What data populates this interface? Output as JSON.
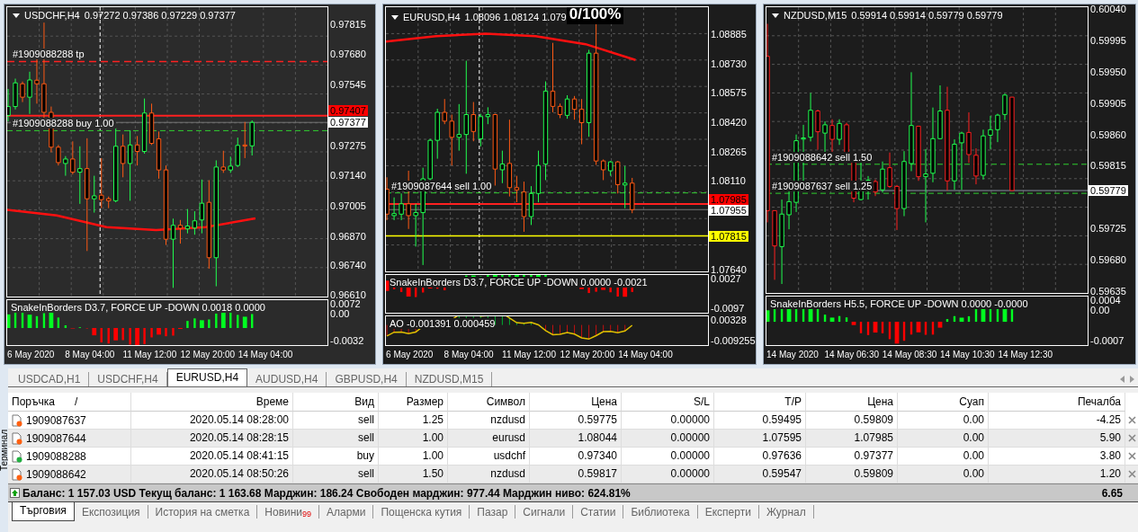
{
  "charts": [
    {
      "title": "USDCHF,H4",
      "ohlc": "0.97272 0.97386 0.97229 0.97377",
      "price_labels": [
        "0.97815",
        "0.97680",
        "0.97545",
        "0.97275",
        "0.97140",
        "0.97005",
        "0.96870",
        "0.96740",
        "0.96610"
      ],
      "price_tags": [
        {
          "text": "0.97407",
          "color": "#ff0000"
        },
        {
          "text": "0.97377",
          "color": "#ffffff"
        }
      ],
      "order_labels": [
        "#1909088288 tp",
        "#1909088288 buy 1.00"
      ],
      "indicators": [
        {
          "kind": "histogram",
          "title": "SnakeInBorders D3.7, FORCE UP -DOWN  0.0018 0.0000",
          "scale": [
            "0.0072",
            "0.00",
            "-0.0032"
          ]
        }
      ],
      "time_labels": [
        "6 May 2020",
        "8 May 04:00",
        "11 May 12:00",
        "12 May 20:00",
        "14 May 04:00"
      ]
    },
    {
      "title": "EURUSD,H4",
      "ohlc": "1.08096 1.08124 1.079",
      "overlay": "0/100%",
      "price_labels": [
        "1.08885",
        "1.08730",
        "1.08575",
        "1.08420",
        "1.08265",
        "1.08110",
        "1.07640"
      ],
      "price_tags": [
        {
          "text": "1.07985",
          "color": "#ff0000"
        },
        {
          "text": "1.07955",
          "color": "#ffffff"
        },
        {
          "text": "1.07815",
          "color": "#ffff00"
        }
      ],
      "order_labels": [
        "#1909087644 sell 1.00"
      ],
      "indicators": [
        {
          "kind": "histogram",
          "title": "SnakeInBorders D3.7, FORCE UP -DOWN  0.0000 -0.0021",
          "scale": [
            "0.0027",
            "-0.0097"
          ]
        },
        {
          "kind": "oscillator",
          "title": "AO -0.001391 0.000459",
          "scale": [
            "0.00328",
            "-0.009255"
          ]
        }
      ],
      "time_labels": [
        "6 May 2020",
        "8 May 04:00",
        "11 May 12:00",
        "12 May 20:00",
        "14 May 04:00"
      ]
    },
    {
      "title": "NZDUSD,M15",
      "ohlc": "0.59914 0.59914 0.59779 0.59779",
      "price_labels": [
        "0.60040",
        "0.59995",
        "0.59950",
        "0.59905",
        "0.59860",
        "0.59815",
        "0.59725",
        "0.59680",
        "0.59635"
      ],
      "price_tags": [
        {
          "text": "0.59779",
          "color": "#ffffff"
        }
      ],
      "order_labels": [
        "#1909088642 sell 1.50",
        "#1909087637 sell 1.25"
      ],
      "indicators": [
        {
          "kind": "histogram",
          "title": "SnakeInBorders H5.5, FORCE UP -DOWN  0.0000 -0.0000",
          "scale": [
            "0.0004",
            "0.00",
            "-0.0007"
          ]
        }
      ],
      "time_labels": [
        "14 May 2020",
        "14 May 06:30",
        "14 May 08:30",
        "14 May 10:30",
        "14 May 12:30"
      ]
    }
  ],
  "symbol_tabs": [
    {
      "label": "USDCAD,H1",
      "selected": false
    },
    {
      "label": "USDCHF,H4",
      "selected": false
    },
    {
      "label": "EURUSD,H4",
      "selected": true
    },
    {
      "label": "AUDUSD,H4",
      "selected": false
    },
    {
      "label": "GBPUSD,H4",
      "selected": false
    },
    {
      "label": "NZDUSD,M15",
      "selected": false
    }
  ],
  "side_label": "Терминал",
  "table": {
    "columns": [
      "Поръчка",
      "Време",
      "Вид",
      "Размер",
      "Символ",
      "Цена",
      "S/L",
      "T/P",
      "Цена",
      "Суап",
      "Печалба"
    ],
    "sort_mark": "/",
    "rows": [
      {
        "kind": "sell",
        "cells": [
          "1909087637",
          "2020.05.14 08:28:00",
          "sell",
          "1.25",
          "nzdusd",
          "0.59775",
          "0.00000",
          "0.59495",
          "0.59809",
          "0.00",
          "-4.25"
        ]
      },
      {
        "kind": "sell",
        "cells": [
          "1909087644",
          "2020.05.14 08:28:15",
          "sell",
          "1.00",
          "eurusd",
          "1.08044",
          "0.00000",
          "1.07595",
          "1.07985",
          "0.00",
          "5.90"
        ]
      },
      {
        "kind": "buy",
        "cells": [
          "1909088288",
          "2020.05.14 08:41:15",
          "buy",
          "1.00",
          "usdchf",
          "0.97340",
          "0.00000",
          "0.97636",
          "0.97377",
          "0.00",
          "3.80"
        ]
      },
      {
        "kind": "sell",
        "cells": [
          "1909088642",
          "2020.05.14 08:50:26",
          "sell",
          "1.50",
          "nzdusd",
          "0.59817",
          "0.00000",
          "0.59547",
          "0.59809",
          "0.00",
          "1.20"
        ]
      }
    ]
  },
  "balance": {
    "text": "Баланс: 1 157.03 USD  Текущ баланс: 1 163.68  Марджин: 186.24  Свободен марджин: 977.44  Марджин ниво: 624.81%",
    "total": "6.65"
  },
  "bottom_tabs": [
    {
      "label": "Търговия",
      "selected": true
    },
    {
      "label": "Експозиция",
      "selected": false
    },
    {
      "label": "История на сметка",
      "selected": false
    },
    {
      "label": "Новини",
      "badge": "99",
      "selected": false
    },
    {
      "label": "Аларми",
      "selected": false
    },
    {
      "label": "Пощенска кутия",
      "selected": false
    },
    {
      "label": "Пазар",
      "selected": false
    },
    {
      "label": "Сигнали",
      "selected": false
    },
    {
      "label": "Статии",
      "selected": false
    },
    {
      "label": "Библиотека",
      "selected": false
    },
    {
      "label": "Експерти",
      "selected": false
    },
    {
      "label": "Журнал",
      "selected": false
    }
  ]
}
